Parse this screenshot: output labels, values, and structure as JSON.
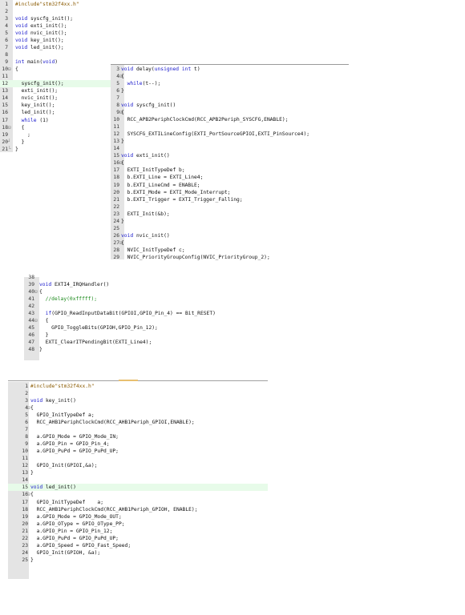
{
  "panels": [
    {
      "id": "main",
      "lines": [
        {
          "n": "1",
          "t": "#include\"stm32f4xx.h\"",
          "c": "pp"
        },
        {
          "n": "2",
          "t": ""
        },
        {
          "n": "3",
          "t": "void syscfg_init();"
        },
        {
          "n": "4",
          "t": "void exti_init();"
        },
        {
          "n": "5",
          "t": "void nvic_init();"
        },
        {
          "n": "6",
          "t": "void key_init();"
        },
        {
          "n": "7",
          "t": "void led_init();"
        },
        {
          "n": "8",
          "t": ""
        },
        {
          "n": "9",
          "t": "int main(void)"
        },
        {
          "n": "10",
          "t": "{",
          "f": "⊟"
        },
        {
          "n": "11",
          "t": ""
        },
        {
          "n": "12",
          "t": "  syscfg_init();",
          "hl": true
        },
        {
          "n": "13",
          "t": "  exti_init();"
        },
        {
          "n": "14",
          "t": "  nvic_init();"
        },
        {
          "n": "15",
          "t": "  key_init();"
        },
        {
          "n": "16",
          "t": "  led_init();"
        },
        {
          "n": "17",
          "t": "  while (1)",
          "c": "kw"
        },
        {
          "n": "18",
          "t": "  {",
          "f": "⊟"
        },
        {
          "n": "19",
          "t": "    ;"
        },
        {
          "n": "20",
          "t": "  }",
          "f": "┘"
        },
        {
          "n": "21",
          "t": "}",
          "f": "└"
        }
      ]
    },
    {
      "id": "functions",
      "lines": [
        {
          "n": "3",
          "t": "void delay(unsigned int t)"
        },
        {
          "n": "4",
          "t": "{",
          "f": "⊟"
        },
        {
          "n": "5",
          "t": "  while(t--);"
        },
        {
          "n": "6",
          "t": "}"
        },
        {
          "n": "7",
          "t": ""
        },
        {
          "n": "8",
          "t": "void syscfg_init()"
        },
        {
          "n": "9",
          "t": "{",
          "f": "⊟"
        },
        {
          "n": "10",
          "t": "  RCC_APB2PeriphClockCmd(RCC_APB2Periph_SYSCFG,ENABLE);"
        },
        {
          "n": "11",
          "t": ""
        },
        {
          "n": "12",
          "t": "  SYSCFG_EXTILineConfig(EXTI_PortSourceGPIOI,EXTI_PinSource4);"
        },
        {
          "n": "13",
          "t": "}"
        },
        {
          "n": "14",
          "t": ""
        },
        {
          "n": "15",
          "t": "void exti_init()"
        },
        {
          "n": "16",
          "t": "{",
          "f": "⊟"
        },
        {
          "n": "17",
          "t": "  EXTI_InitTypeDef b;"
        },
        {
          "n": "18",
          "t": "  b.EXTI_Line = EXTI_Line4;"
        },
        {
          "n": "19",
          "t": "  b.EXTI_LineCmd = ENABLE;"
        },
        {
          "n": "20",
          "t": "  b.EXTI_Mode = EXTI_Mode_Interrupt;"
        },
        {
          "n": "21",
          "t": "  b.EXTI_Trigger = EXTI_Trigger_Falling;"
        },
        {
          "n": "22",
          "t": ""
        },
        {
          "n": "23",
          "t": "  EXTI_Init(&b);"
        },
        {
          "n": "24",
          "t": "}"
        },
        {
          "n": "25",
          "t": ""
        },
        {
          "n": "26",
          "t": "void nvic_init()"
        },
        {
          "n": "27",
          "t": "{",
          "f": "⊟"
        },
        {
          "n": "28",
          "t": "  NVIC_InitTypeDef c;"
        },
        {
          "n": "29",
          "t": "  NVIC_PriorityGroupConfig(NVIC_PriorityGroup_2);"
        }
      ]
    },
    {
      "id": "irq",
      "lines": [
        {
          "n": "38",
          "t": ""
        },
        {
          "n": "39",
          "t": "void EXTI4_IRQHandler()"
        },
        {
          "n": "40",
          "t": "{",
          "f": "⊟"
        },
        {
          "n": "41",
          "t": "  //delay(0xfffff);",
          "c": "cm"
        },
        {
          "n": "42",
          "t": ""
        },
        {
          "n": "43",
          "t": "  if(GPIO_ReadInputDataBit(GPIOI,GPIO_Pin_4) == Bit_RESET)"
        },
        {
          "n": "44",
          "t": "  {",
          "f": "⊟"
        },
        {
          "n": "45",
          "t": "    GPIO_ToggleBits(GPIOH,GPIO_Pin_12);"
        },
        {
          "n": "46",
          "t": "  }"
        },
        {
          "n": "47",
          "t": "  EXTI_ClearITPendingBit(EXTI_Line4);"
        },
        {
          "n": "48",
          "t": "}"
        }
      ]
    },
    {
      "id": "gpio",
      "lines": [
        {
          "n": "1",
          "t": "#include\"stm32f4xx.h\"",
          "c": "pp"
        },
        {
          "n": "2",
          "t": ""
        },
        {
          "n": "3",
          "t": "void key_init()"
        },
        {
          "n": "4",
          "t": "{",
          "f": "⊟"
        },
        {
          "n": "5",
          "t": "  GPIO_InitTypeDef a;"
        },
        {
          "n": "6",
          "t": "  RCC_AHB1PeriphClockCmd(RCC_AHB1Periph_GPIOI,ENABLE);"
        },
        {
          "n": "7",
          "t": ""
        },
        {
          "n": "8",
          "t": "  a.GPIO_Mode = GPIO_Mode_IN;"
        },
        {
          "n": "9",
          "t": "  a.GPIO_Pin = GPIO_Pin_4;"
        },
        {
          "n": "10",
          "t": "  a.GPIO_PuPd = GPIO_PuPd_UP;"
        },
        {
          "n": "11",
          "t": ""
        },
        {
          "n": "12",
          "t": "  GPIO_Init(GPIOI,&a);"
        },
        {
          "n": "13",
          "t": "}"
        },
        {
          "n": "14",
          "t": ""
        },
        {
          "n": "15",
          "t": "void led_init()",
          "hl": true
        },
        {
          "n": "16",
          "t": "{",
          "f": "⊟"
        },
        {
          "n": "17",
          "t": "  GPIO_InitTypeDef    a;"
        },
        {
          "n": "18",
          "t": "  RCC_AHB1PeriphClockCmd(RCC_AHB1Periph_GPIOH, ENABLE);"
        },
        {
          "n": "19",
          "t": "  a.GPIO_Mode = GPIO_Mode_OUT;"
        },
        {
          "n": "20",
          "t": "  a.GPIO_OType = GPIO_OType_PP;"
        },
        {
          "n": "21",
          "t": "  a.GPIO_Pin = GPIO_Pin_12;"
        },
        {
          "n": "22",
          "t": "  a.GPIO_PuPd = GPIO_PuPd_UP;"
        },
        {
          "n": "23",
          "t": "  a.GPIO_Speed = GPIO_Fast_Speed;"
        },
        {
          "n": "24",
          "t": "  GPIO_Init(GPIOH, &a);"
        },
        {
          "n": "25",
          "t": "}"
        }
      ]
    }
  ],
  "colors": {
    "gutter": "#e4e4e4",
    "keyword": "#1a1acc",
    "preprocessor": "#8a5a00",
    "comment": "#1b8a1b",
    "current_line": "#e7fbe9"
  }
}
